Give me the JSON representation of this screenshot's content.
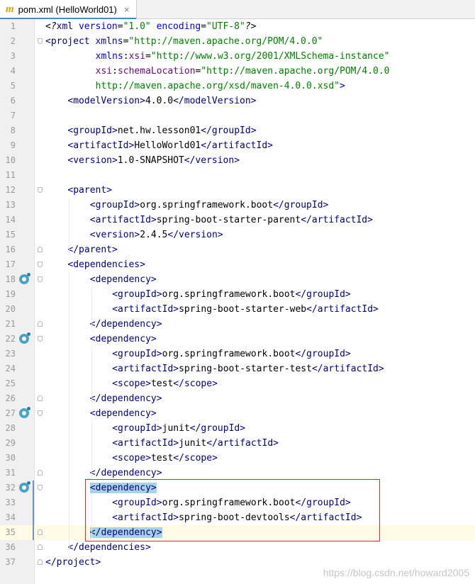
{
  "tab": {
    "icon_letter": "m",
    "title": "pom.xml (HelloWorld01)",
    "close": "×"
  },
  "lines": [
    {
      "n": "1",
      "indent": 0,
      "fold": "",
      "marker": false,
      "tokens": [
        [
          "pi",
          "<?"
        ],
        [
          "tag",
          "xml "
        ],
        [
          "attr",
          "version"
        ],
        [
          "text",
          "="
        ],
        [
          "str",
          "\"1.0\""
        ],
        [
          "text",
          " "
        ],
        [
          "attr",
          "encoding"
        ],
        [
          "text",
          "="
        ],
        [
          "str",
          "\"UTF-8\""
        ],
        [
          "pi",
          "?>"
        ]
      ]
    },
    {
      "n": "2",
      "indent": 0,
      "fold": "up",
      "marker": false,
      "tokens": [
        [
          "tag",
          "<project "
        ],
        [
          "attr",
          "xmlns"
        ],
        [
          "text",
          "="
        ],
        [
          "str",
          "\"http://maven.apache.org/POM/4.0.0\""
        ]
      ]
    },
    {
      "n": "3",
      "indent": 9,
      "fold": "",
      "marker": false,
      "tokens": [
        [
          "attr",
          "xmlns"
        ],
        [
          "text",
          ":"
        ],
        [
          "ns",
          "xsi"
        ],
        [
          "text",
          "="
        ],
        [
          "str",
          "\"http://www.w3.org/2001/XMLSchema-instance\""
        ]
      ]
    },
    {
      "n": "4",
      "indent": 9,
      "fold": "",
      "marker": false,
      "tokens": [
        [
          "ns",
          "xsi"
        ],
        [
          "text",
          ":"
        ],
        [
          "ns",
          "schemaLocation"
        ],
        [
          "text",
          "="
        ],
        [
          "str",
          "\"http://maven.apache.org/POM/4.0.0"
        ]
      ]
    },
    {
      "n": "5",
      "indent": 9,
      "fold": "",
      "marker": false,
      "tokens": [
        [
          "str",
          "http://maven.apache.org/xsd/maven-4.0.0.xsd\""
        ],
        [
          "tag",
          ">"
        ]
      ]
    },
    {
      "n": "6",
      "indent": 4,
      "fold": "",
      "marker": false,
      "tokens": [
        [
          "tag",
          "<modelVersion>"
        ],
        [
          "text",
          "4.0.0"
        ],
        [
          "tag",
          "</modelVersion>"
        ]
      ]
    },
    {
      "n": "7",
      "indent": 0,
      "fold": "",
      "marker": false,
      "tokens": []
    },
    {
      "n": "8",
      "indent": 4,
      "fold": "",
      "marker": false,
      "tokens": [
        [
          "tag",
          "<groupId>"
        ],
        [
          "text",
          "net.hw.lesson01"
        ],
        [
          "tag",
          "</groupId>"
        ]
      ]
    },
    {
      "n": "9",
      "indent": 4,
      "fold": "",
      "marker": false,
      "tokens": [
        [
          "tag",
          "<artifactId>"
        ],
        [
          "text",
          "HelloWorld01"
        ],
        [
          "tag",
          "</artifactId>"
        ]
      ]
    },
    {
      "n": "10",
      "indent": 4,
      "fold": "",
      "marker": false,
      "tokens": [
        [
          "tag",
          "<version>"
        ],
        [
          "text",
          "1.0-SNAPSHOT"
        ],
        [
          "tag",
          "</version>"
        ]
      ]
    },
    {
      "n": "11",
      "indent": 0,
      "fold": "",
      "marker": false,
      "tokens": []
    },
    {
      "n": "12",
      "indent": 4,
      "fold": "up",
      "marker": false,
      "tokens": [
        [
          "tag",
          "<parent>"
        ]
      ]
    },
    {
      "n": "13",
      "indent": 8,
      "fold": "",
      "marker": false,
      "tokens": [
        [
          "tag",
          "<groupId>"
        ],
        [
          "text",
          "org.springframework.boot"
        ],
        [
          "tag",
          "</groupId>"
        ]
      ]
    },
    {
      "n": "14",
      "indent": 8,
      "fold": "",
      "marker": false,
      "tokens": [
        [
          "tag",
          "<artifactId>"
        ],
        [
          "text",
          "spring-boot-starter-parent"
        ],
        [
          "tag",
          "</artifactId>"
        ]
      ]
    },
    {
      "n": "15",
      "indent": 8,
      "fold": "",
      "marker": false,
      "tokens": [
        [
          "tag",
          "<version>"
        ],
        [
          "text",
          "2.4.5"
        ],
        [
          "tag",
          "</version>"
        ]
      ]
    },
    {
      "n": "16",
      "indent": 4,
      "fold": "down",
      "marker": false,
      "tokens": [
        [
          "tag",
          "</parent>"
        ]
      ]
    },
    {
      "n": "17",
      "indent": 4,
      "fold": "up",
      "marker": false,
      "tokens": [
        [
          "tag",
          "<dependencies>"
        ]
      ]
    },
    {
      "n": "18",
      "indent": 8,
      "fold": "up",
      "marker": true,
      "tokens": [
        [
          "tag",
          "<dependency>"
        ]
      ]
    },
    {
      "n": "19",
      "indent": 12,
      "fold": "",
      "marker": false,
      "tokens": [
        [
          "tag",
          "<groupId>"
        ],
        [
          "text",
          "org.springframework.boot"
        ],
        [
          "tag",
          "</groupId>"
        ]
      ]
    },
    {
      "n": "20",
      "indent": 12,
      "fold": "",
      "marker": false,
      "tokens": [
        [
          "tag",
          "<artifactId>"
        ],
        [
          "text",
          "spring-boot-starter-web"
        ],
        [
          "tag",
          "</artifactId>"
        ]
      ]
    },
    {
      "n": "21",
      "indent": 8,
      "fold": "down",
      "marker": false,
      "tokens": [
        [
          "tag",
          "</dependency>"
        ]
      ]
    },
    {
      "n": "22",
      "indent": 8,
      "fold": "up",
      "marker": true,
      "tokens": [
        [
          "tag",
          "<dependency>"
        ]
      ]
    },
    {
      "n": "23",
      "indent": 12,
      "fold": "",
      "marker": false,
      "tokens": [
        [
          "tag",
          "<groupId>"
        ],
        [
          "text",
          "org.springframework.boot"
        ],
        [
          "tag",
          "</groupId>"
        ]
      ]
    },
    {
      "n": "24",
      "indent": 12,
      "fold": "",
      "marker": false,
      "tokens": [
        [
          "tag",
          "<artifactId>"
        ],
        [
          "text",
          "spring-boot-starter-test"
        ],
        [
          "tag",
          "</artifactId>"
        ]
      ]
    },
    {
      "n": "25",
      "indent": 12,
      "fold": "",
      "marker": false,
      "tokens": [
        [
          "tag",
          "<scope>"
        ],
        [
          "text",
          "test"
        ],
        [
          "tag",
          "</scope>"
        ]
      ]
    },
    {
      "n": "26",
      "indent": 8,
      "fold": "down",
      "marker": false,
      "tokens": [
        [
          "tag",
          "</dependency>"
        ]
      ]
    },
    {
      "n": "27",
      "indent": 8,
      "fold": "up",
      "marker": true,
      "tokens": [
        [
          "tag",
          "<dependency>"
        ]
      ]
    },
    {
      "n": "28",
      "indent": 12,
      "fold": "",
      "marker": false,
      "tokens": [
        [
          "tag",
          "<groupId>"
        ],
        [
          "text",
          "junit"
        ],
        [
          "tag",
          "</groupId>"
        ]
      ]
    },
    {
      "n": "29",
      "indent": 12,
      "fold": "",
      "marker": false,
      "tokens": [
        [
          "tag",
          "<artifactId>"
        ],
        [
          "text",
          "junit"
        ],
        [
          "tag",
          "</artifactId>"
        ]
      ]
    },
    {
      "n": "30",
      "indent": 12,
      "fold": "",
      "marker": false,
      "tokens": [
        [
          "tag",
          "<scope>"
        ],
        [
          "text",
          "test"
        ],
        [
          "tag",
          "</scope>"
        ]
      ]
    },
    {
      "n": "31",
      "indent": 8,
      "fold": "down",
      "marker": false,
      "tokens": [
        [
          "tag",
          "</dependency>"
        ]
      ]
    },
    {
      "n": "32",
      "indent": 8,
      "fold": "up",
      "marker": true,
      "tokens": [
        [
          "taghl",
          "<dependency>"
        ]
      ]
    },
    {
      "n": "33",
      "indent": 12,
      "fold": "",
      "marker": false,
      "tokens": [
        [
          "tag",
          "<groupId>"
        ],
        [
          "text",
          "org.springframework.boot"
        ],
        [
          "tag",
          "</groupId>"
        ]
      ]
    },
    {
      "n": "34",
      "indent": 12,
      "fold": "",
      "marker": false,
      "tokens": [
        [
          "tag",
          "<artifactId>"
        ],
        [
          "text",
          "spring-boot-devtools"
        ],
        [
          "tag",
          "</artifactId>"
        ]
      ]
    },
    {
      "n": "35",
      "indent": 8,
      "fold": "down",
      "marker": false,
      "current": true,
      "tokens": [
        [
          "taghl",
          "</dependency>"
        ]
      ]
    },
    {
      "n": "36",
      "indent": 4,
      "fold": "down",
      "marker": false,
      "tokens": [
        [
          "tag",
          "</dependencies>"
        ]
      ]
    },
    {
      "n": "37",
      "indent": 0,
      "fold": "down",
      "marker": false,
      "tokens": [
        [
          "tag",
          "</project>"
        ]
      ]
    }
  ],
  "watermark": "https://blog.csdn.net/howard2005"
}
